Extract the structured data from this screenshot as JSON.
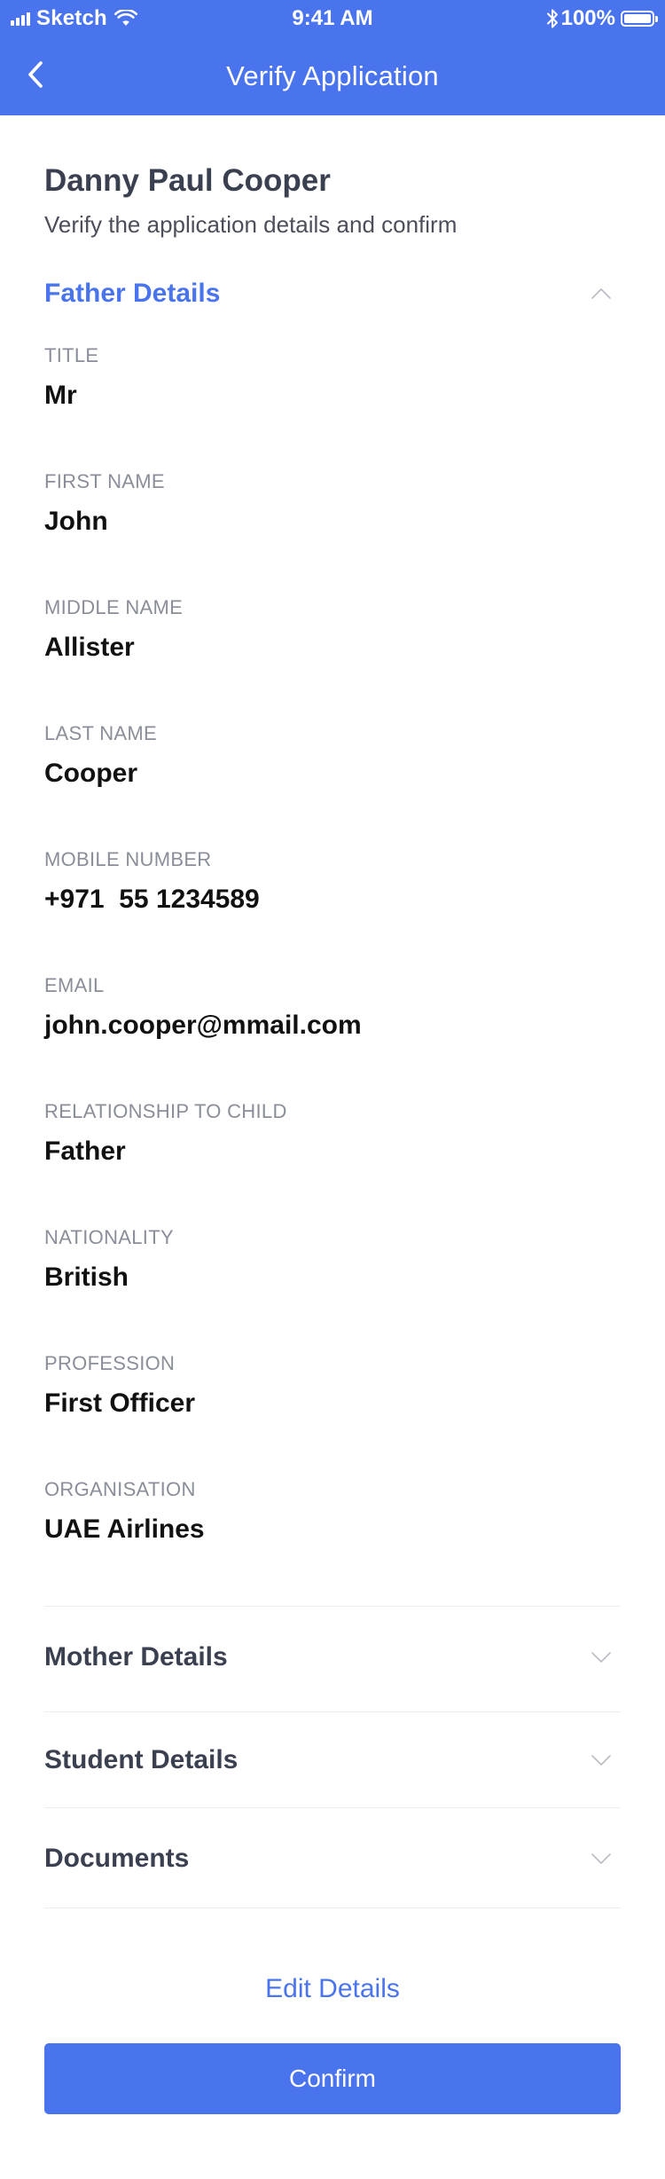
{
  "status_bar": {
    "carrier": "Sketch",
    "time": "9:41 AM",
    "battery": "100%",
    "icons": [
      "signal-icon",
      "wifi-icon",
      "bluetooth-icon",
      "battery-icon"
    ]
  },
  "nav": {
    "title": "Verify Application",
    "back_icon": "chevron-left-icon"
  },
  "applicant": {
    "name": "Danny Paul Cooper",
    "subtitle": "Verify the application details and confirm"
  },
  "sections": [
    {
      "title": "Father Details",
      "expanded": true,
      "icon": "chevron-up-icon"
    },
    {
      "title": "Mother Details",
      "expanded": false,
      "icon": "chevron-down-icon"
    },
    {
      "title": "Student Details",
      "expanded": false,
      "icon": "chevron-down-icon"
    },
    {
      "title": "Documents",
      "expanded": false,
      "icon": "chevron-down-icon"
    }
  ],
  "father_fields": [
    {
      "label": "TITLE",
      "value": "Mr"
    },
    {
      "label": "FIRST NAME",
      "value": "John"
    },
    {
      "label": "MIDDLE NAME",
      "value": "Allister"
    },
    {
      "label": "LAST NAME",
      "value": "Cooper"
    },
    {
      "label": "MOBILE NUMBER",
      "value": "+971  55 1234589"
    },
    {
      "label": "EMAIL",
      "value": "john.cooper@mmail.com"
    },
    {
      "label": "RELATIONSHIP TO CHILD",
      "value": "Father"
    },
    {
      "label": "NATIONALITY",
      "value": "British"
    },
    {
      "label": "PROFESSION",
      "value": "First Officer"
    },
    {
      "label": "ORGANISATION",
      "value": "UAE Airlines"
    }
  ],
  "actions": {
    "edit_label": "Edit Details",
    "confirm_label": "Confirm"
  },
  "colors": {
    "accent": "#4a74ee",
    "heading": "#3b4050",
    "label": "#8a8e99",
    "value": "#111111",
    "divider": "#ececec"
  }
}
